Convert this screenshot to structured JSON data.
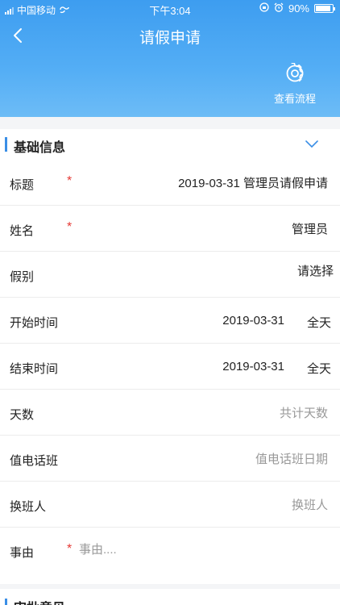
{
  "status": {
    "carrier": "中国移动",
    "time": "下午3:04",
    "battery": "90%",
    "battery_level": 0.9
  },
  "nav": {
    "title": "请假申请",
    "flow_label": "查看流程"
  },
  "section": {
    "title": "基础信息"
  },
  "form": {
    "title_label": "标题",
    "title_value": "2019-03-31 管理员请假申请",
    "name_label": "姓名",
    "name_value": "管理员",
    "leave_type_label": "假别",
    "leave_type_value": "请选择",
    "start_label": "开始时间",
    "start_date": "2019-03-31",
    "start_period": "全天",
    "end_label": "结束时间",
    "end_date": "2019-03-31",
    "end_period": "全天",
    "days_label": "天数",
    "days_placeholder": "共计天数",
    "duty_label": "值电话班",
    "duty_placeholder": "值电话班日期",
    "shift_label": "换班人",
    "shift_placeholder": "换班人",
    "reason_label": "事由",
    "reason_placeholder": "事由....",
    "required_mark": "*"
  },
  "section2": {
    "title": "审批意见"
  }
}
